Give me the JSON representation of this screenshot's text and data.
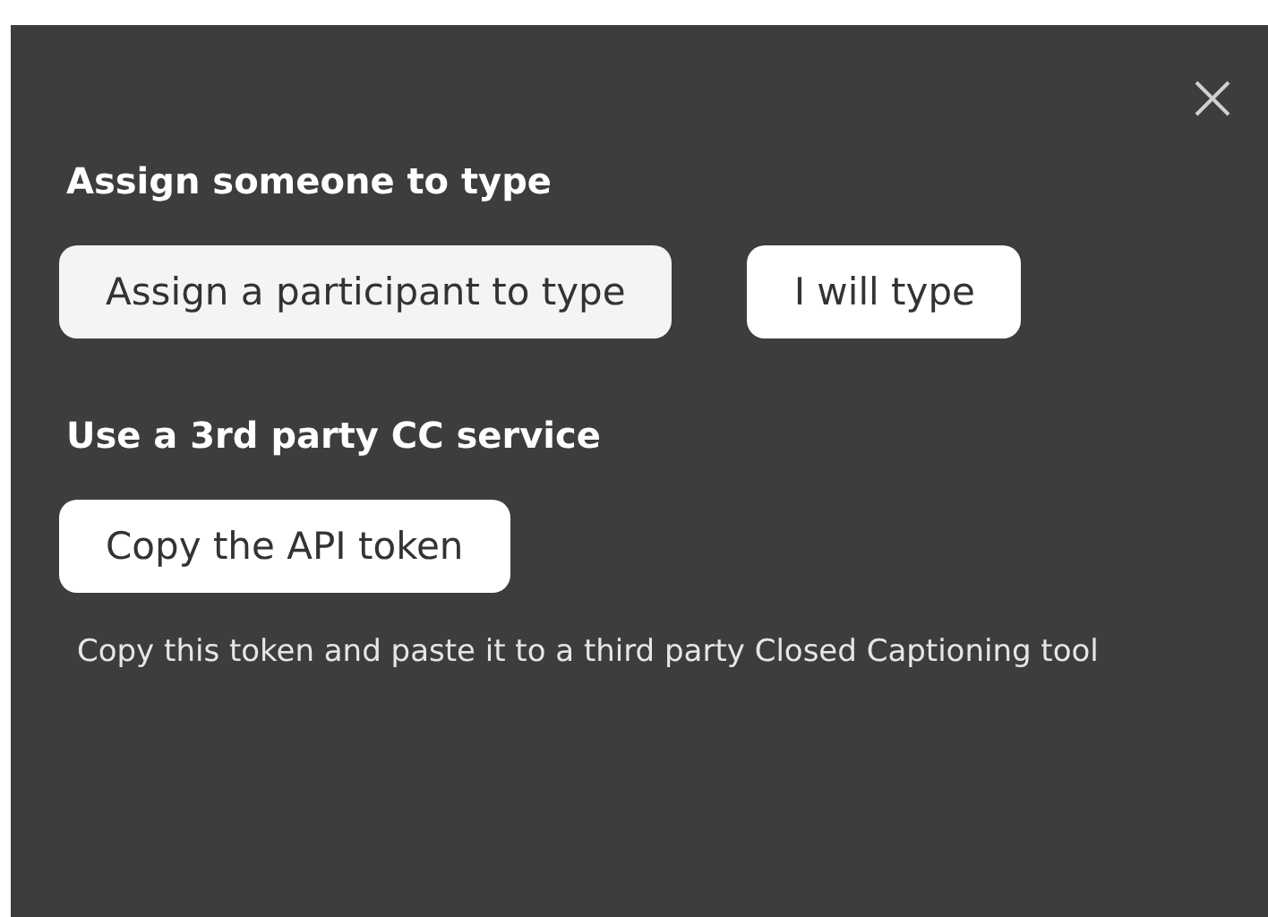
{
  "sections": [
    {
      "title": "Assign someone to type",
      "buttons": [
        {
          "label": "Assign a participant to type",
          "selected": true
        },
        {
          "label": "I will type",
          "selected": false
        }
      ]
    },
    {
      "title": "Use a 3rd party CC service",
      "buttons": [
        {
          "label": "Copy the API token",
          "selected": false
        }
      ],
      "description": "Copy this token and paste it to a third party Closed Captioning tool"
    }
  ]
}
